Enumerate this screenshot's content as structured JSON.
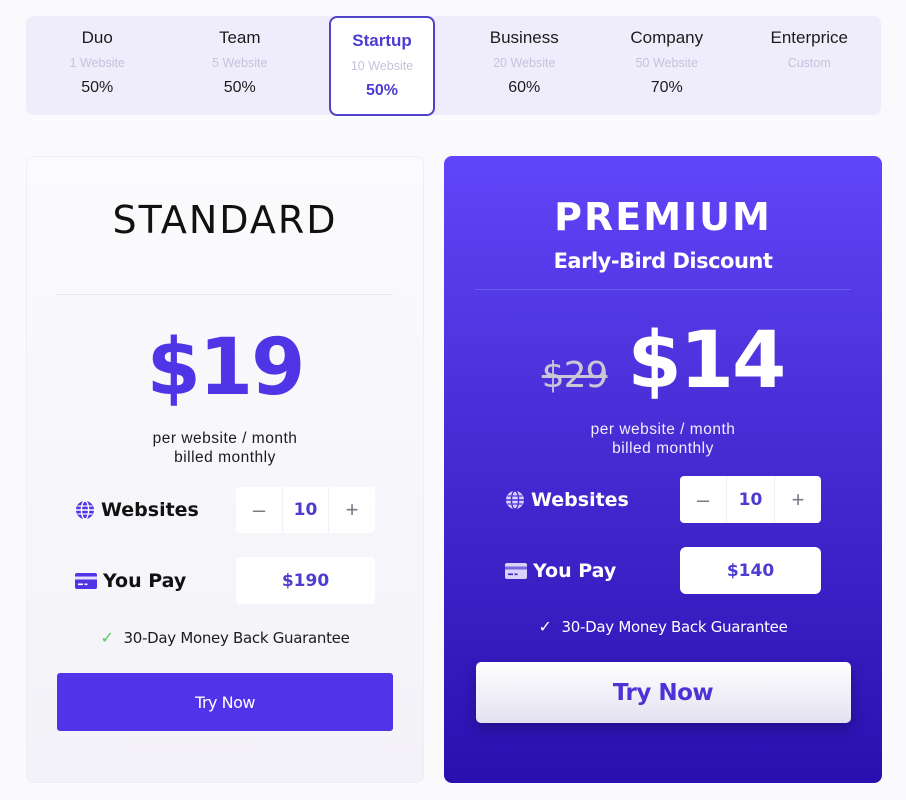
{
  "tiers": [
    {
      "name": "Duo",
      "websites": "1 Website",
      "discount": "50%"
    },
    {
      "name": "Team",
      "websites": "5 Website",
      "discount": "50%"
    },
    {
      "name": "Startup",
      "websites": "10 Website",
      "discount": "50%",
      "selected": true
    },
    {
      "name": "Business",
      "websites": "20 Website",
      "discount": "60%"
    },
    {
      "name": "Company",
      "websites": "50 Website",
      "discount": "70%"
    },
    {
      "name": "Enterprice",
      "websites": "Custom",
      "discount": ""
    }
  ],
  "standard": {
    "title": "STANDARD",
    "price": "$19",
    "billing_line1": "per website / month",
    "billing_line2": "billed monthly",
    "websites_label": "Websites",
    "websites_value": "10",
    "minus": "–",
    "plus": "+",
    "pay_label": "You Pay",
    "pay_value": "$190",
    "guarantee": "30-Day Money Back Guarantee",
    "cta": "Try Now"
  },
  "premium": {
    "title": "PREMIUM",
    "subtitle": "Early-Bird Discount",
    "old_price": "$29",
    "price": "$14",
    "billing_line1": "per website / month",
    "billing_line2": "billed monthly",
    "websites_label": "Websites",
    "websites_value": "10",
    "minus": "–",
    "plus": "+",
    "pay_label": "You Pay",
    "pay_value": "$140",
    "guarantee": "30-Day Money Back Guarantee",
    "cta": "Try Now"
  },
  "icons": {
    "websites": "globe-icon",
    "pay": "credit-card-icon",
    "guarantee": "check-icon"
  },
  "colors": {
    "accent": "#5133ea",
    "accent_text": "#4d3ccf",
    "premium_top": "#6145f9",
    "premium_bottom": "#2a0fb0",
    "check_green": "#5cc55c"
  }
}
